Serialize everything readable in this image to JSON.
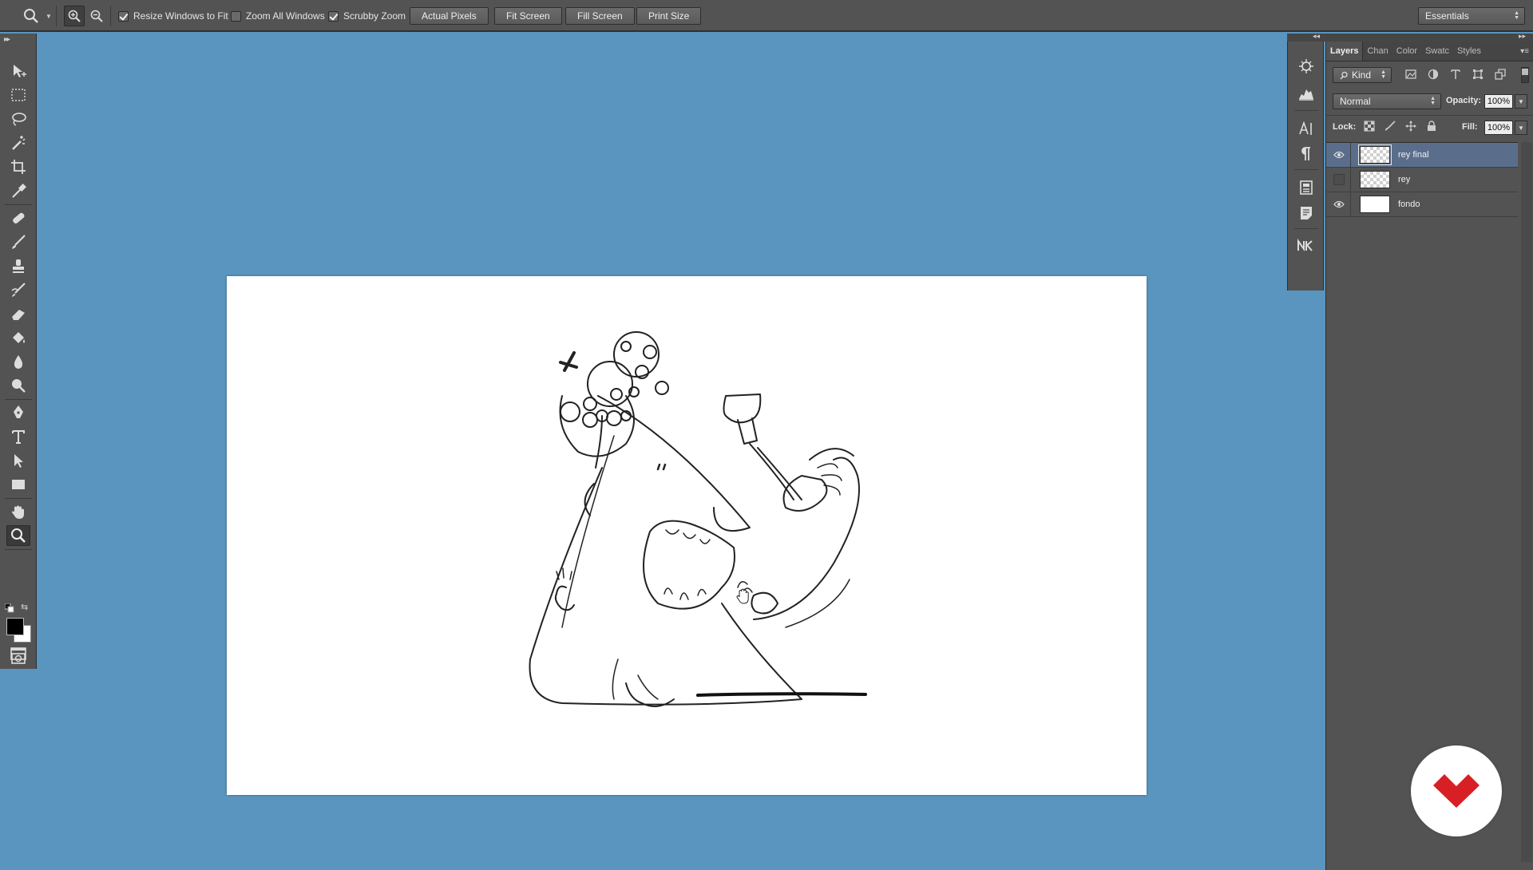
{
  "options_bar": {
    "resize_windows_label": "Resize Windows to Fit",
    "resize_windows_checked": true,
    "zoom_all_label": "Zoom All Windows",
    "zoom_all_checked": false,
    "scrubby_zoom_label": "Scrubby Zoom",
    "scrubby_zoom_checked": true,
    "buttons": [
      "Actual Pixels",
      "Fit Screen",
      "Fill Screen",
      "Print Size"
    ],
    "workspace": "Essentials"
  },
  "toolbar": {
    "active_tool": "zoom-tool",
    "foreground_color": "#000000",
    "background_color": "#ffffff"
  },
  "canvas": {
    "workspace_bg": "#5a95bf",
    "document_bg": "#ffffff"
  },
  "layers_panel": {
    "tabs": [
      "Layers",
      "Chan",
      "Color",
      "Swatc",
      "Styles"
    ],
    "active_tab": "Layers",
    "filter_kind": "Kind",
    "blend_mode": "Normal",
    "opacity_label": "Opacity:",
    "opacity_value": "100%",
    "lock_label": "Lock:",
    "fill_label": "Fill:",
    "fill_value": "100%",
    "layers": [
      {
        "name": "rey final",
        "visible": true,
        "selected": true,
        "thumb": "transparent"
      },
      {
        "name": "rey",
        "visible": false,
        "selected": false,
        "thumb": "transparent"
      },
      {
        "name": "fondo",
        "visible": true,
        "selected": false,
        "thumb": "white"
      }
    ]
  },
  "colors": {
    "panel": "#535353",
    "selection": "#5a6e8c",
    "logo_red": "#d81f26"
  }
}
